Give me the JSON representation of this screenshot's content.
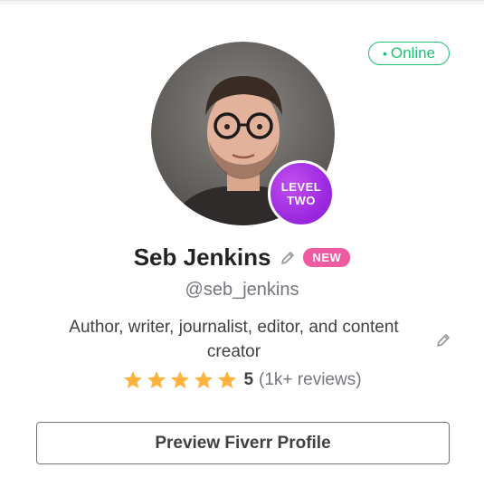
{
  "status": {
    "label": "Online",
    "color": "#1dbf73"
  },
  "seller": {
    "level_line1": "LEVEL",
    "level_line2": "TWO",
    "name": "Seb Jenkins",
    "badge": "NEW",
    "username": "@seb_jenkins",
    "description": "Author, writer, journalist, editor, and content creator"
  },
  "rating": {
    "stars": 5,
    "value": "5",
    "count": "(1k+ reviews)",
    "star_color": "#ffb33e"
  },
  "actions": {
    "preview_label": "Preview Fiverr Profile"
  },
  "icons": {
    "edit": "pencil-icon",
    "star": "star-icon",
    "avatar": "avatar-photo"
  }
}
